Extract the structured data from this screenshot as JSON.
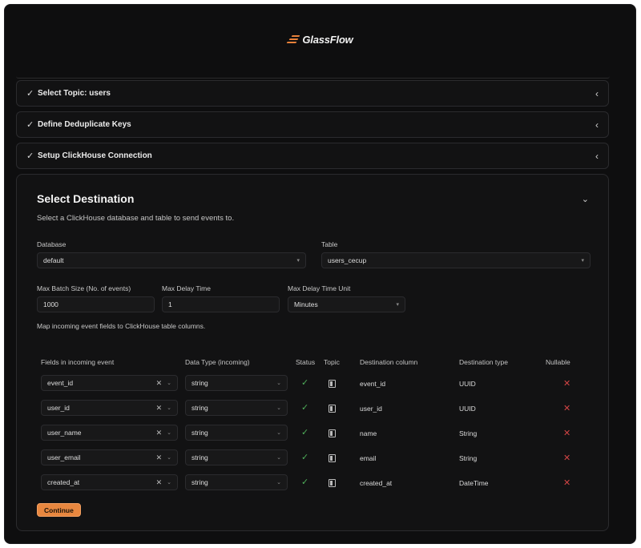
{
  "app": {
    "logo_text": "GlassFlow"
  },
  "steps": [
    {
      "label": "Select Topic: users"
    },
    {
      "label": "Define Deduplicate Keys"
    },
    {
      "label": "Setup ClickHouse Connection"
    }
  ],
  "destination": {
    "title": "Select Destination",
    "subtitle": "Select a ClickHouse database and table to send events to.",
    "database_label": "Database",
    "database_value": "default",
    "table_label": "Table",
    "table_value": "users_cecup",
    "batch_label": "Max Batch Size (No. of events)",
    "batch_value": "1000",
    "delay_label": "Max Delay Time",
    "delay_value": "1",
    "unit_label": "Max Delay Time Unit",
    "unit_value": "Minutes",
    "map_note": "Map incoming event fields to ClickHouse table columns.",
    "continue_label": "Continue"
  },
  "table": {
    "headers": {
      "field": "Fields in incoming event",
      "type": "Data Type (incoming)",
      "status": "Status",
      "topic": "Topic",
      "dest_col": "Destination column",
      "dest_type": "Destination type",
      "nullable": "Nullable"
    },
    "rows": [
      {
        "field": "event_id",
        "type": "string",
        "dest_col": "event_id",
        "dest_type": "UUID"
      },
      {
        "field": "user_id",
        "type": "string",
        "dest_col": "user_id",
        "dest_type": "UUID"
      },
      {
        "field": "user_name",
        "type": "string",
        "dest_col": "name",
        "dest_type": "String"
      },
      {
        "field": "user_email",
        "type": "string",
        "dest_col": "email",
        "dest_type": "String"
      },
      {
        "field": "created_at",
        "type": "string",
        "dest_col": "created_at",
        "dest_type": "DateTime"
      }
    ]
  },
  "colors": {
    "accent": "#e8873f",
    "ok": "#4fae5a",
    "error": "#d24545",
    "background": "#0e0e0f"
  },
  "icons": {
    "check": "check-icon",
    "collapse": "chevron-left-icon",
    "expand": "chevron-down-icon",
    "clear": "close-icon",
    "topic": "topic-icon",
    "nullable_false": "x-icon"
  }
}
